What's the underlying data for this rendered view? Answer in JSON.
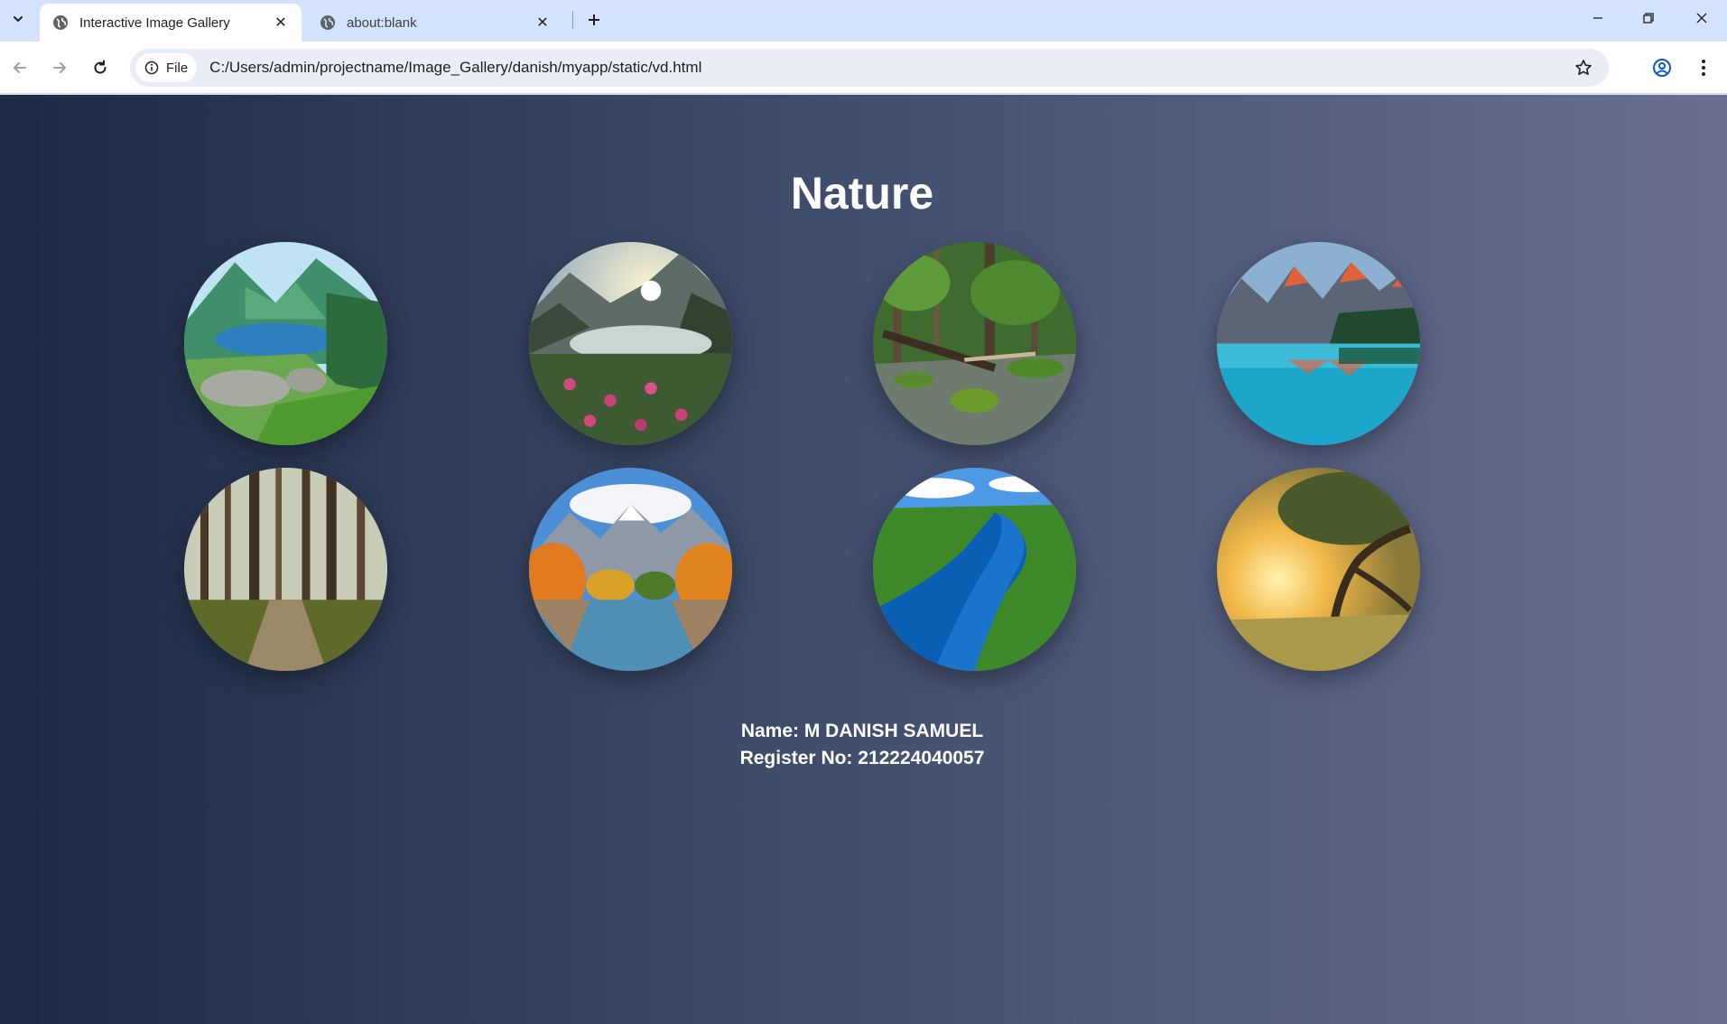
{
  "browser": {
    "tabs": [
      {
        "title": "Interactive Image Gallery",
        "active": true
      },
      {
        "title": "about:blank",
        "active": false
      }
    ],
    "address": {
      "scheme_label": "File",
      "url": "C:/Users/admin/projectname/Image_Gallery/danish/myapp/static/vd.html"
    },
    "icons": {
      "tab_search": "chevron-down-icon",
      "back": "back-arrow-icon",
      "forward": "forward-arrow-icon",
      "reload": "reload-icon",
      "info": "info-icon",
      "bookmark": "star-icon",
      "profile": "profile-icon",
      "menu": "kebab-menu-icon"
    }
  },
  "page": {
    "heading": "Nature",
    "gallery": [
      {
        "subject": "mountain lake with mossy rocks"
      },
      {
        "subject": "sunburst over alpine lake and wildflowers"
      },
      {
        "subject": "forest stream with fallen log"
      },
      {
        "subject": "red-peaked mountains reflected in turquoise lake"
      },
      {
        "subject": "forest path among tall pines"
      },
      {
        "subject": "autumn trees by mountain lake"
      },
      {
        "subject": "aerial view of blue river through forest"
      },
      {
        "subject": "tree silhouette at golden sunset"
      }
    ],
    "credits": {
      "name": "Name: M DANISH SAMUEL",
      "register": "Register No: 212224040057"
    }
  },
  "colors": {
    "tabstrip": "#d3e3fd",
    "page_gradient_start": "#1e2b45",
    "page_gradient_end": "#6a6f93",
    "text": "#ffffff"
  }
}
